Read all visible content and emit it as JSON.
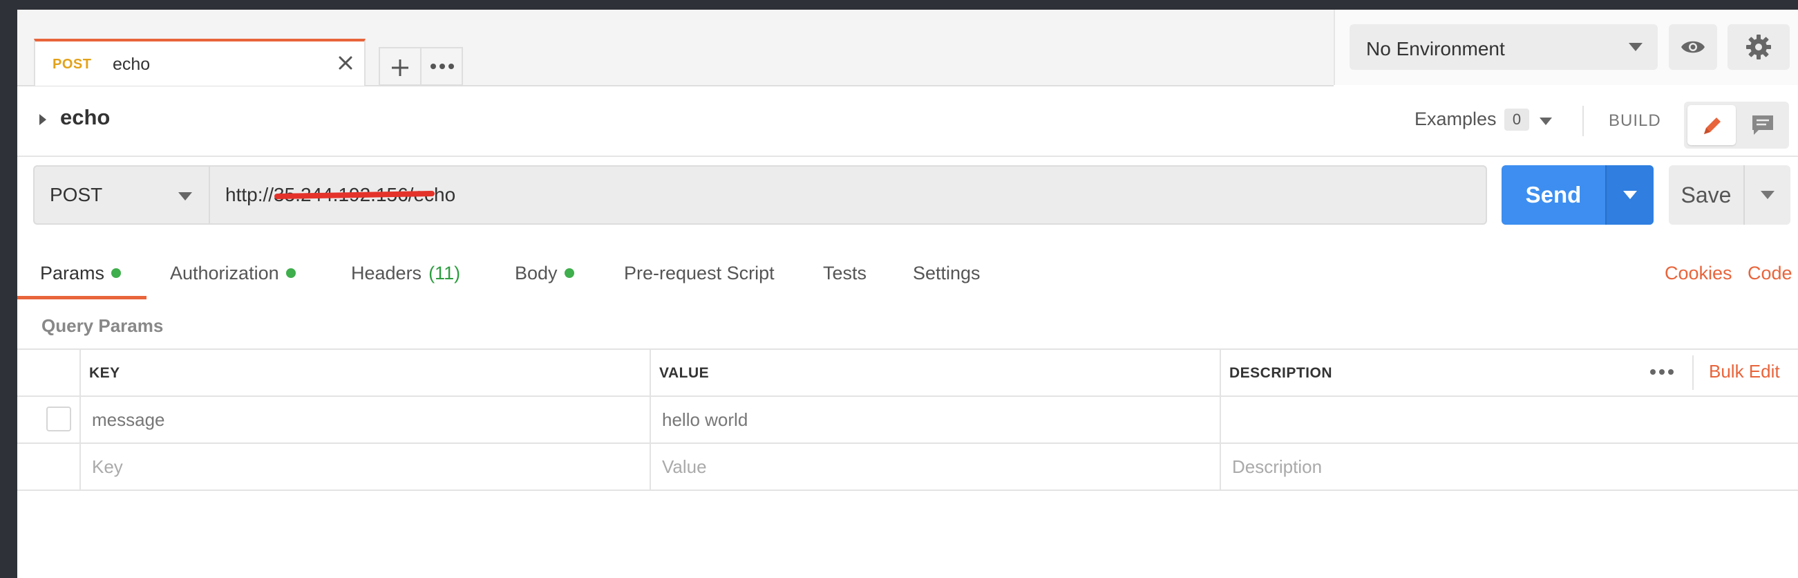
{
  "tab": {
    "method": "POST",
    "name": "echo"
  },
  "environment": {
    "selected": "No Environment"
  },
  "request": {
    "title": "echo",
    "examples_label": "Examples",
    "examples_count": "0",
    "mode_label": "BUILD",
    "method": "POST",
    "url": "http://35.244.192.156/echo",
    "send_label": "Send",
    "save_label": "Save"
  },
  "request_tabs": {
    "params": "Params",
    "authorization": "Authorization",
    "headers": "Headers",
    "headers_count": "(11)",
    "body": "Body",
    "pre_request": "Pre-request Script",
    "tests": "Tests",
    "settings": "Settings",
    "cookies": "Cookies",
    "code": "Code"
  },
  "query_params": {
    "title": "Query Params",
    "columns": {
      "key": "KEY",
      "value": "VALUE",
      "description": "DESCRIPTION"
    },
    "bulk_edit": "Bulk Edit",
    "rows": [
      {
        "key": "message",
        "value": "hello world",
        "description": ""
      }
    ],
    "placeholders": {
      "key": "Key",
      "value": "Value",
      "description": "Description"
    }
  },
  "colors": {
    "accent": "#e8643b",
    "send": "#3d8ef0",
    "status_dot": "#3fae4c",
    "method_tab": "#e3a21a"
  },
  "icons": [
    "close-icon",
    "plus-icon",
    "more-icon",
    "chevron-down-icon",
    "eye-icon",
    "gear-icon",
    "caret-right-icon",
    "pencil-icon",
    "comment-icon"
  ]
}
